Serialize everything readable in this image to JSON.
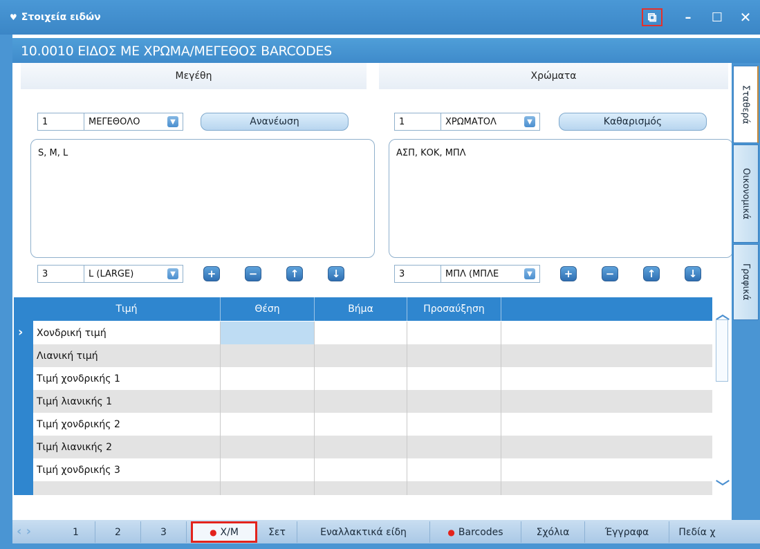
{
  "window": {
    "title": "Στοιχεία ειδών",
    "header": "10.0010 ΕΙΔΟΣ ΜΕ ΧΡΩΜΑ/ΜΕΓΕΘΟΣ BARCODES"
  },
  "sizes": {
    "section_title": "Μεγέθη",
    "code": "1",
    "combo_value": "ΜΕΓΕΘΟΛΟ",
    "refresh_button": "Ανανέωση",
    "list_text": "S, M, L",
    "selected_index": "3",
    "selected_value": "L (LARGE)"
  },
  "colors": {
    "section_title": "Χρώματα",
    "code": "1",
    "combo_value": "ΧΡΩΜΑΤΟΛ",
    "clear_button": "Καθαρισμός",
    "list_text": "ΑΣΠ, ΚΟΚ, ΜΠΛ",
    "selected_index": "3",
    "selected_value": "ΜΠΛ (ΜΠΛΕ"
  },
  "vtabs": [
    "Σταθερά",
    "Οικονομικά",
    "Γραφικά"
  ],
  "grid": {
    "columns": [
      "Τιμή",
      "Θέση",
      "Βήμα",
      "Προσαύξηση"
    ],
    "rows": [
      "Χονδρική τιμή",
      "Λιανική τιμή",
      "Τιμή χονδρικής 1",
      "Τιμή λιανικής 1",
      "Τιμή χονδρικής 2",
      "Τιμή λιανικής 2",
      "Τιμή χονδρικής 3"
    ]
  },
  "bottom_tabs": [
    "1",
    "2",
    "3",
    "Χ/Μ",
    "Σετ",
    "Εναλλακτικά είδη",
    "Barcodes",
    "Σχόλια",
    "Έγγραφα",
    "Πεδία χ"
  ],
  "colors_theme": {
    "accent": "#3f8bcb",
    "highlight": "#e3231c"
  }
}
